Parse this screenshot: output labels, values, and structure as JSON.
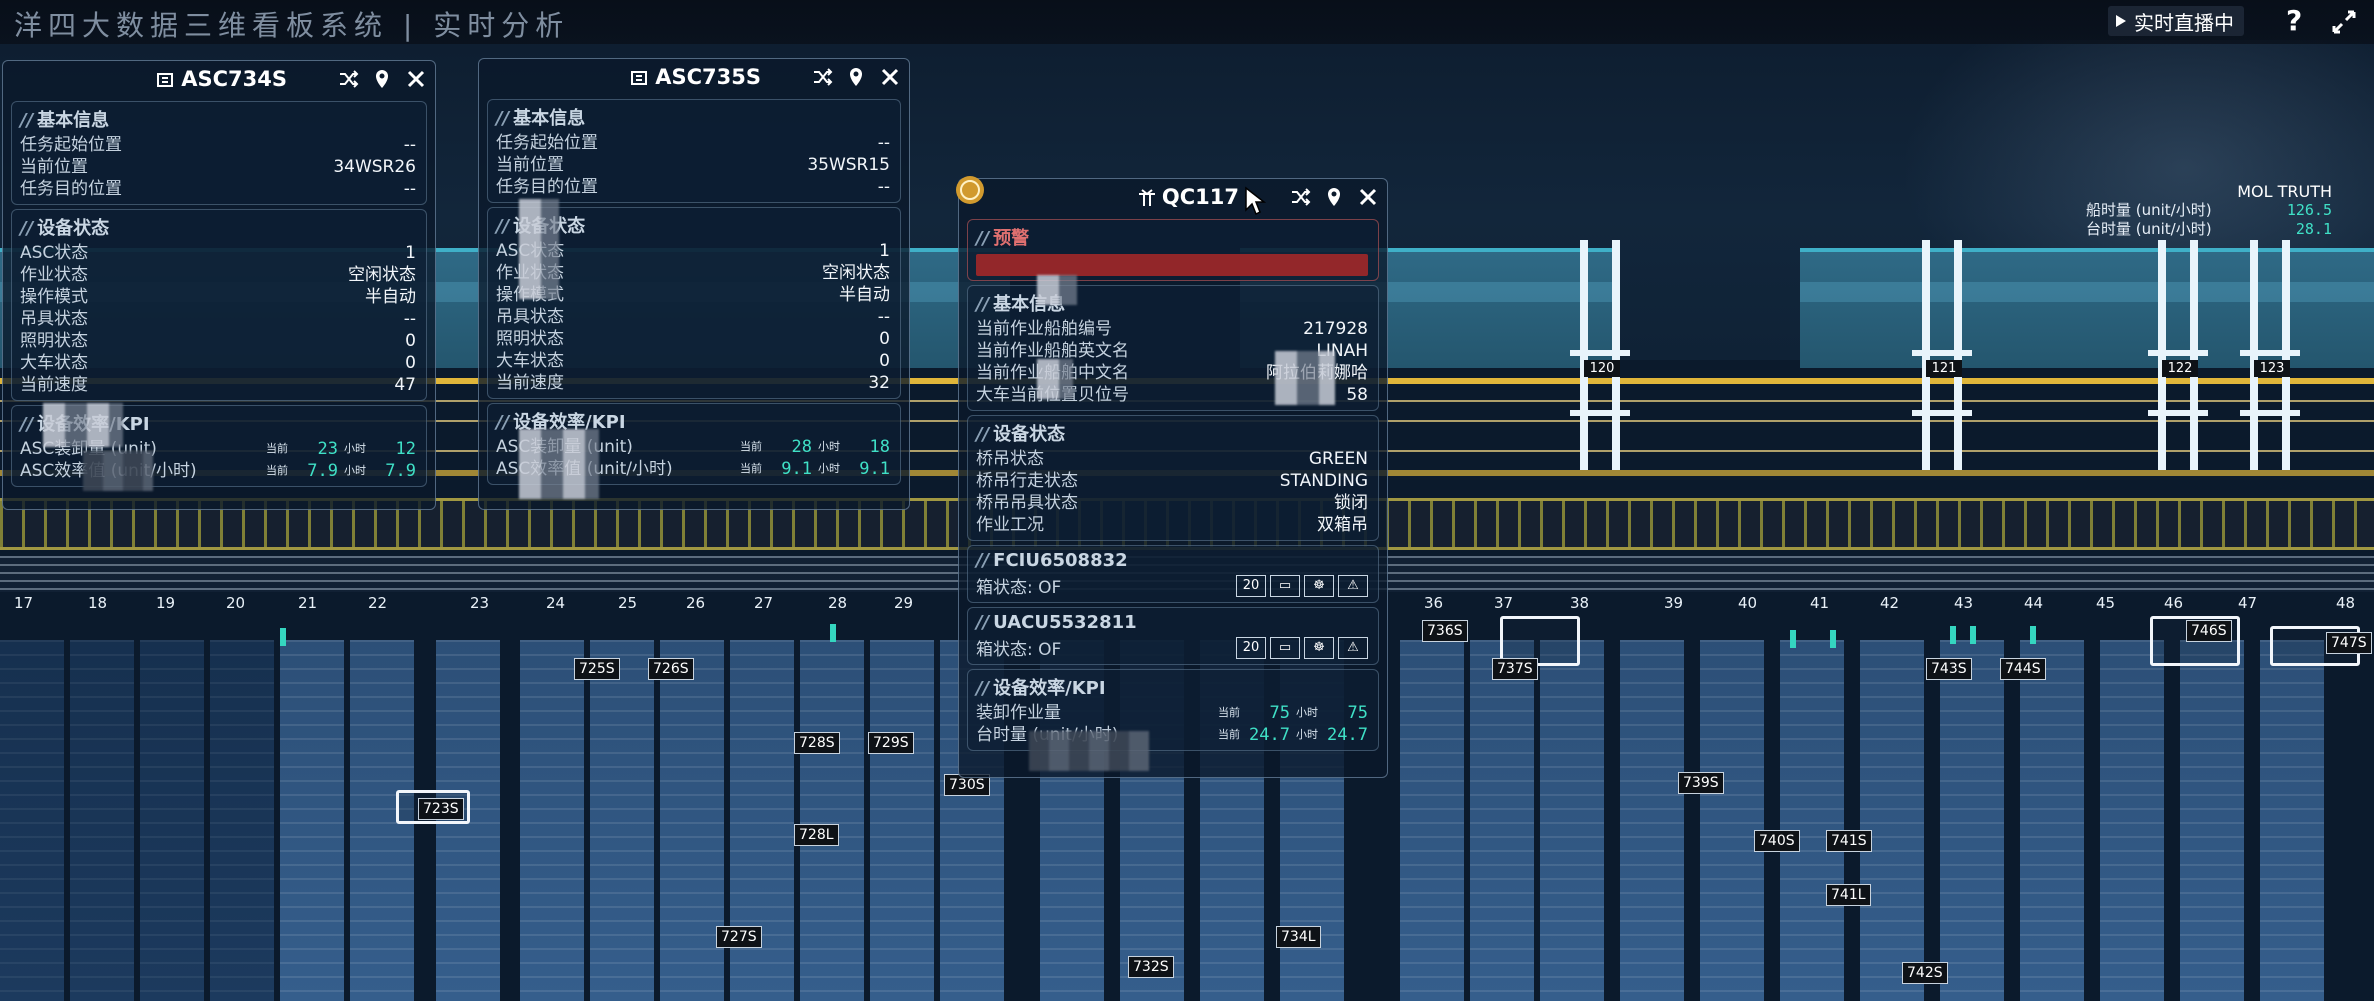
{
  "header": {
    "title": "洋四大数据三维看板系统  |  实时分析",
    "live_label": "实时直播中",
    "help_label": "?"
  },
  "mol_panel": {
    "title": "MOL TRUTH",
    "rows": [
      {
        "label": "船时量 (unit/小时)",
        "value": "126.5"
      },
      {
        "label": "台时量 (unit/小时)",
        "value": "28.1"
      }
    ]
  },
  "panels": {
    "asc734": {
      "title": "ASC734S",
      "basic_title": "基本信息",
      "basic": [
        {
          "k": "任务起始位置",
          "v": "--"
        },
        {
          "k": "当前位置",
          "v": "34WSR26"
        },
        {
          "k": "任务目的位置",
          "v": "--"
        }
      ],
      "status_title": "设备状态",
      "status": [
        {
          "k": "ASC状态",
          "v": "1"
        },
        {
          "k": "作业状态",
          "v": "空闲状态"
        },
        {
          "k": "操作模式",
          "v": "半自动"
        },
        {
          "k": "吊具状态",
          "v": "--"
        },
        {
          "k": "照明状态",
          "v": "0"
        },
        {
          "k": "大车状态",
          "v": "0"
        },
        {
          "k": "当前速度",
          "v": "47"
        }
      ],
      "kpi_title": "设备效率/KPI",
      "kpi": [
        {
          "k": "ASC装卸量 (unit)",
          "t1": "当前",
          "n1": "23",
          "t2": "小时",
          "n2": "12"
        },
        {
          "k": "ASC效率值 (unit/小时)",
          "t1": "当前",
          "n1": "7.9",
          "t2": "小时",
          "n2": "7.9"
        }
      ]
    },
    "asc735": {
      "title": "ASC735S",
      "basic_title": "基本信息",
      "basic": [
        {
          "k": "任务起始位置",
          "v": "--"
        },
        {
          "k": "当前位置",
          "v": "35WSR15"
        },
        {
          "k": "任务目的位置",
          "v": "--"
        }
      ],
      "status_title": "设备状态",
      "status": [
        {
          "k": "ASC状态",
          "v": "1"
        },
        {
          "k": "作业状态",
          "v": "空闲状态"
        },
        {
          "k": "操作模式",
          "v": "半自动"
        },
        {
          "k": "吊具状态",
          "v": "--"
        },
        {
          "k": "照明状态",
          "v": "0"
        },
        {
          "k": "大车状态",
          "v": "0"
        },
        {
          "k": "当前速度",
          "v": "32"
        }
      ],
      "kpi_title": "设备效率/KPI",
      "kpi": [
        {
          "k": "ASC装卸量 (unit)",
          "t1": "当前",
          "n1": "28",
          "t2": "小时",
          "n2": "18"
        },
        {
          "k": "ASC效率值 (unit/小时)",
          "t1": "当前",
          "n1": "9.1",
          "t2": "小时",
          "n2": "9.1"
        }
      ]
    },
    "qc117": {
      "title": "QC117",
      "alarm_title": "预警",
      "alarm_text": "",
      "basic_title": "基本信息",
      "basic": [
        {
          "k": "当前作业船舶编号",
          "v": "217928"
        },
        {
          "k": "当前作业船舶英文名",
          "v": "LINAH"
        },
        {
          "k": "当前作业船舶中文名",
          "v": "阿拉伯莉娜哈"
        },
        {
          "k": "大车当前位置贝位号",
          "v": "58"
        }
      ],
      "status_title": "设备状态",
      "status": [
        {
          "k": "桥吊状态",
          "v": "GREEN"
        },
        {
          "k": "桥吊行走状态",
          "v": "STANDING"
        },
        {
          "k": "桥吊吊具状态",
          "v": "锁闭"
        },
        {
          "k": "作业工况",
          "v": "双箱吊"
        }
      ],
      "boxes": [
        {
          "id": "FCIU6508832",
          "state_label": "箱状态: OF",
          "size": "20"
        },
        {
          "id": "UACU5532811",
          "state_label": "箱状态: OF",
          "size": "20"
        }
      ],
      "kpi_title": "设备效率/KPI",
      "kpi": [
        {
          "k": "装卸作业量",
          "t1": "当前",
          "n1": "75",
          "t2": "小时",
          "n2": "75"
        },
        {
          "k": "台时量 (unit/小时)",
          "t1": "当前",
          "n1": "24.7",
          "t2": "小时",
          "n2": "24.7"
        }
      ]
    }
  },
  "sts_cranes": [
    "120",
    "121",
    "122",
    "123"
  ],
  "bays": [
    "17",
    "18",
    "19",
    "20",
    "21",
    "22",
    "23",
    "24",
    "25",
    "26",
    "27",
    "28",
    "29",
    "36",
    "37",
    "38",
    "39",
    "40",
    "41",
    "42",
    "43",
    "44",
    "45",
    "46",
    "47",
    "48"
  ],
  "vehicles": [
    "723S",
    "725S",
    "726S",
    "728S",
    "729S",
    "730S",
    "728L",
    "727S",
    "732S",
    "734L",
    "736S",
    "737S",
    "739S",
    "740S",
    "741S",
    "741L",
    "742S",
    "743S",
    "744S",
    "746S",
    "747S"
  ]
}
